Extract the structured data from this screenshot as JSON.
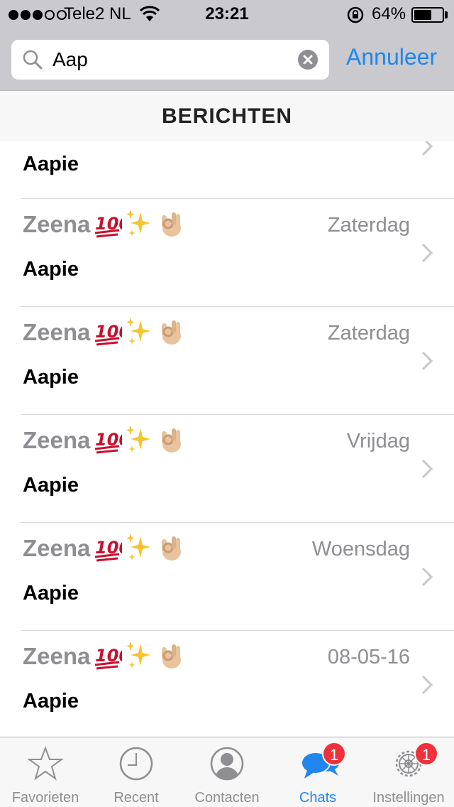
{
  "status_bar": {
    "carrier": "Tele2 NL",
    "time": "23:21",
    "battery_percent": "64%",
    "battery_level": 0.64
  },
  "search": {
    "value": "Aap",
    "cancel_label": "Annuleer"
  },
  "section": {
    "title": "BERICHTEN"
  },
  "partial_row": {
    "message": "Aapie"
  },
  "rows": [
    {
      "name": "Zeena",
      "date": "Zaterdag",
      "message": "Aapie"
    },
    {
      "name": "Zeena",
      "date": "Zaterdag",
      "message": "Aapie"
    },
    {
      "name": "Zeena",
      "date": "Vrijdag",
      "message": "Aapie"
    },
    {
      "name": "Zeena",
      "date": "Woensdag",
      "message": "Aapie"
    },
    {
      "name": "Zeena",
      "date": "08-05-16",
      "message": "Aapie"
    }
  ],
  "tabs": [
    {
      "label": "Favorieten",
      "icon": "star-icon",
      "active": false,
      "badge": ""
    },
    {
      "label": "Recent",
      "icon": "clock-icon",
      "active": false,
      "badge": ""
    },
    {
      "label": "Contacten",
      "icon": "contact-icon",
      "active": false,
      "badge": ""
    },
    {
      "label": "Chats",
      "icon": "chat-bubbles-icon",
      "active": true,
      "badge": "1"
    },
    {
      "label": "Instellingen",
      "icon": "gear-icon",
      "active": false,
      "badge": "1"
    }
  ],
  "colors": {
    "accent": "#1f86f0",
    "badge": "#f0303a",
    "secondary_text": "#8e8e93"
  }
}
